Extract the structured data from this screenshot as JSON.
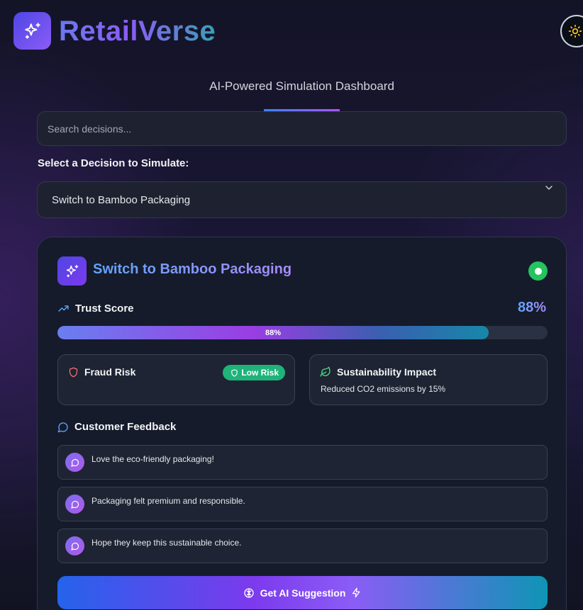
{
  "header": {
    "brand": "RetailVerse",
    "logo_icon": "sparkles-icon",
    "theme_toggle_icon": "sun-icon"
  },
  "subtitle": "AI-Powered Simulation Dashboard",
  "search": {
    "placeholder": "Search decisions...",
    "value": ""
  },
  "decision_select": {
    "label": "Select a Decision to Simulate:",
    "selected": "Switch to Bamboo Packaging"
  },
  "card": {
    "title": "Switch to Bamboo Packaging",
    "status_color": "#22c55e",
    "trust": {
      "label": "Trust Score",
      "value_text": "88%",
      "bar_label": "88%",
      "value": 0.88
    },
    "fraud": {
      "label": "Fraud Risk",
      "badge": "Low Risk",
      "badge_color": "#1fb37a"
    },
    "sustainability": {
      "label": "Sustainability Impact",
      "description": "Reduced CO2 emissions by 15%"
    },
    "feedback": {
      "heading": "Customer Feedback",
      "items": [
        {
          "text": "Love the eco-friendly packaging!"
        },
        {
          "text": "Packaging felt premium and responsible."
        },
        {
          "text": "Hope they keep this sustainable choice."
        }
      ]
    },
    "ai_button": "Get AI Suggestion"
  },
  "colors": {
    "accent_blue": "#3b82f6",
    "accent_purple": "#a855f7",
    "success": "#22c55e",
    "card_bg": "#151b2b"
  }
}
